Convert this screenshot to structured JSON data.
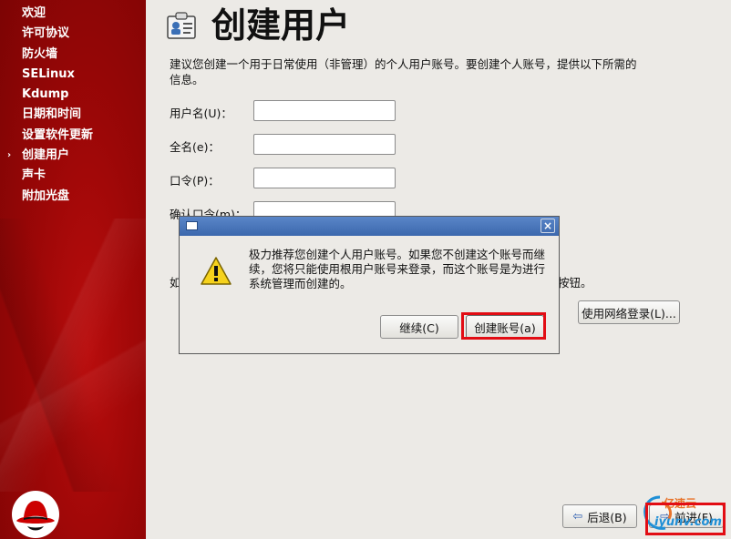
{
  "sidebar": {
    "items": [
      {
        "label": "欢迎",
        "current": false
      },
      {
        "label": "许可协议",
        "current": false
      },
      {
        "label": "防火墙",
        "current": false
      },
      {
        "label": "SELinux",
        "current": false
      },
      {
        "label": "Kdump",
        "current": false
      },
      {
        "label": "日期和时间",
        "current": false
      },
      {
        "label": "设置软件更新",
        "current": false
      },
      {
        "label": "创建用户",
        "current": true
      },
      {
        "label": "声卡",
        "current": false
      },
      {
        "label": "附加光盘",
        "current": false
      }
    ],
    "current_marker": "›"
  },
  "page": {
    "title": "创建用户",
    "description": "建议您创建一个用于日常使用（非管理）的个人用户账号。要创建个人账号，提供以下所需的信息。"
  },
  "form": {
    "username_label": "用户名(U)：",
    "fullname_label": "全名(e)：",
    "password_label": "口令(P)：",
    "confirm_label": "确认口令(m)：",
    "username_value": "",
    "fullname_value": "",
    "password_value": "",
    "confirm_value": ""
  },
  "partially_hidden": {
    "left_text": "如",
    "right_text": "按钮。"
  },
  "buttons": {
    "network_login": "使用网络登录(L)...",
    "back": "后退(B)",
    "next": "前进(F)"
  },
  "dialog": {
    "message": "极力推荐您创建个人用户账号。如果您不创建这个账号而继续，您将只能使用根用户账号来登录，而这个账号是为进行系统管理而创建的。",
    "close_symbol": "×",
    "continue_label": "继续(C)",
    "create_label": "创建账号(a)"
  },
  "watermark": {
    "line1": "亿速云",
    "line2": "iyunv.com"
  },
  "colors": {
    "sidebar_red": "#9c0707",
    "titlebar_blue": "#3c68ad",
    "highlight_red": "#e20d14"
  }
}
